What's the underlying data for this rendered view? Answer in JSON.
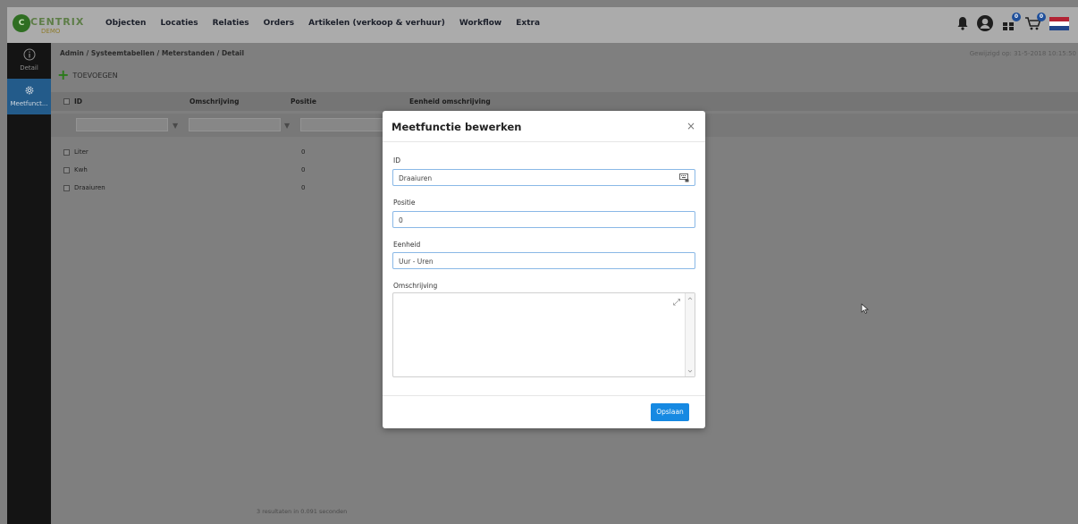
{
  "header": {
    "logo_text": "CENTRIX",
    "logo_mark": "C",
    "logo_sub": "DEMO",
    "nav": [
      "Objecten",
      "Locaties",
      "Relaties",
      "Orders",
      "Artikelen (verkoop & verhuur)",
      "Workflow",
      "Extra"
    ],
    "badges": {
      "grid": "0",
      "cart": "0"
    },
    "flag_colors": [
      "#b22334",
      "#ffffff",
      "#21468b"
    ]
  },
  "sidebar": {
    "items": [
      {
        "label": "Detail",
        "icon": "info-icon"
      },
      {
        "label": "Meetfunct...",
        "icon": "gear-icon"
      }
    ]
  },
  "page": {
    "breadcrumb": "Admin / Systeemtabellen / Meterstanden / Detail",
    "changed": "Gewijzigd op: 31-5-2018 10:15:50",
    "add_label": "TOEVOEGEN",
    "columns": [
      "ID",
      "Omschrijving",
      "Positie",
      "Eenheid omschrijving"
    ],
    "rows": [
      {
        "id": "Liter",
        "positie": "0"
      },
      {
        "id": "Kwh",
        "positie": "0"
      },
      {
        "id": "Draaiuren",
        "positie": "0"
      }
    ],
    "footer": "3 resultaten in 0.091 seconden"
  },
  "modal": {
    "title": "Meetfunctie bewerken",
    "close": "×",
    "id_label": "ID",
    "id_value": "Draaiuren",
    "positie_label": "Positie",
    "positie_value": "0",
    "eenheid_label": "Eenheid",
    "eenheid_value": "Uur - Uren",
    "omschrijving_label": "Omschrijving",
    "omschrijving_value": "",
    "save_label": "Opslaan"
  },
  "colors": {
    "accent": "#1689e2",
    "sidebar_active": "#235b8a",
    "add_icon": "#2b7a1a"
  }
}
